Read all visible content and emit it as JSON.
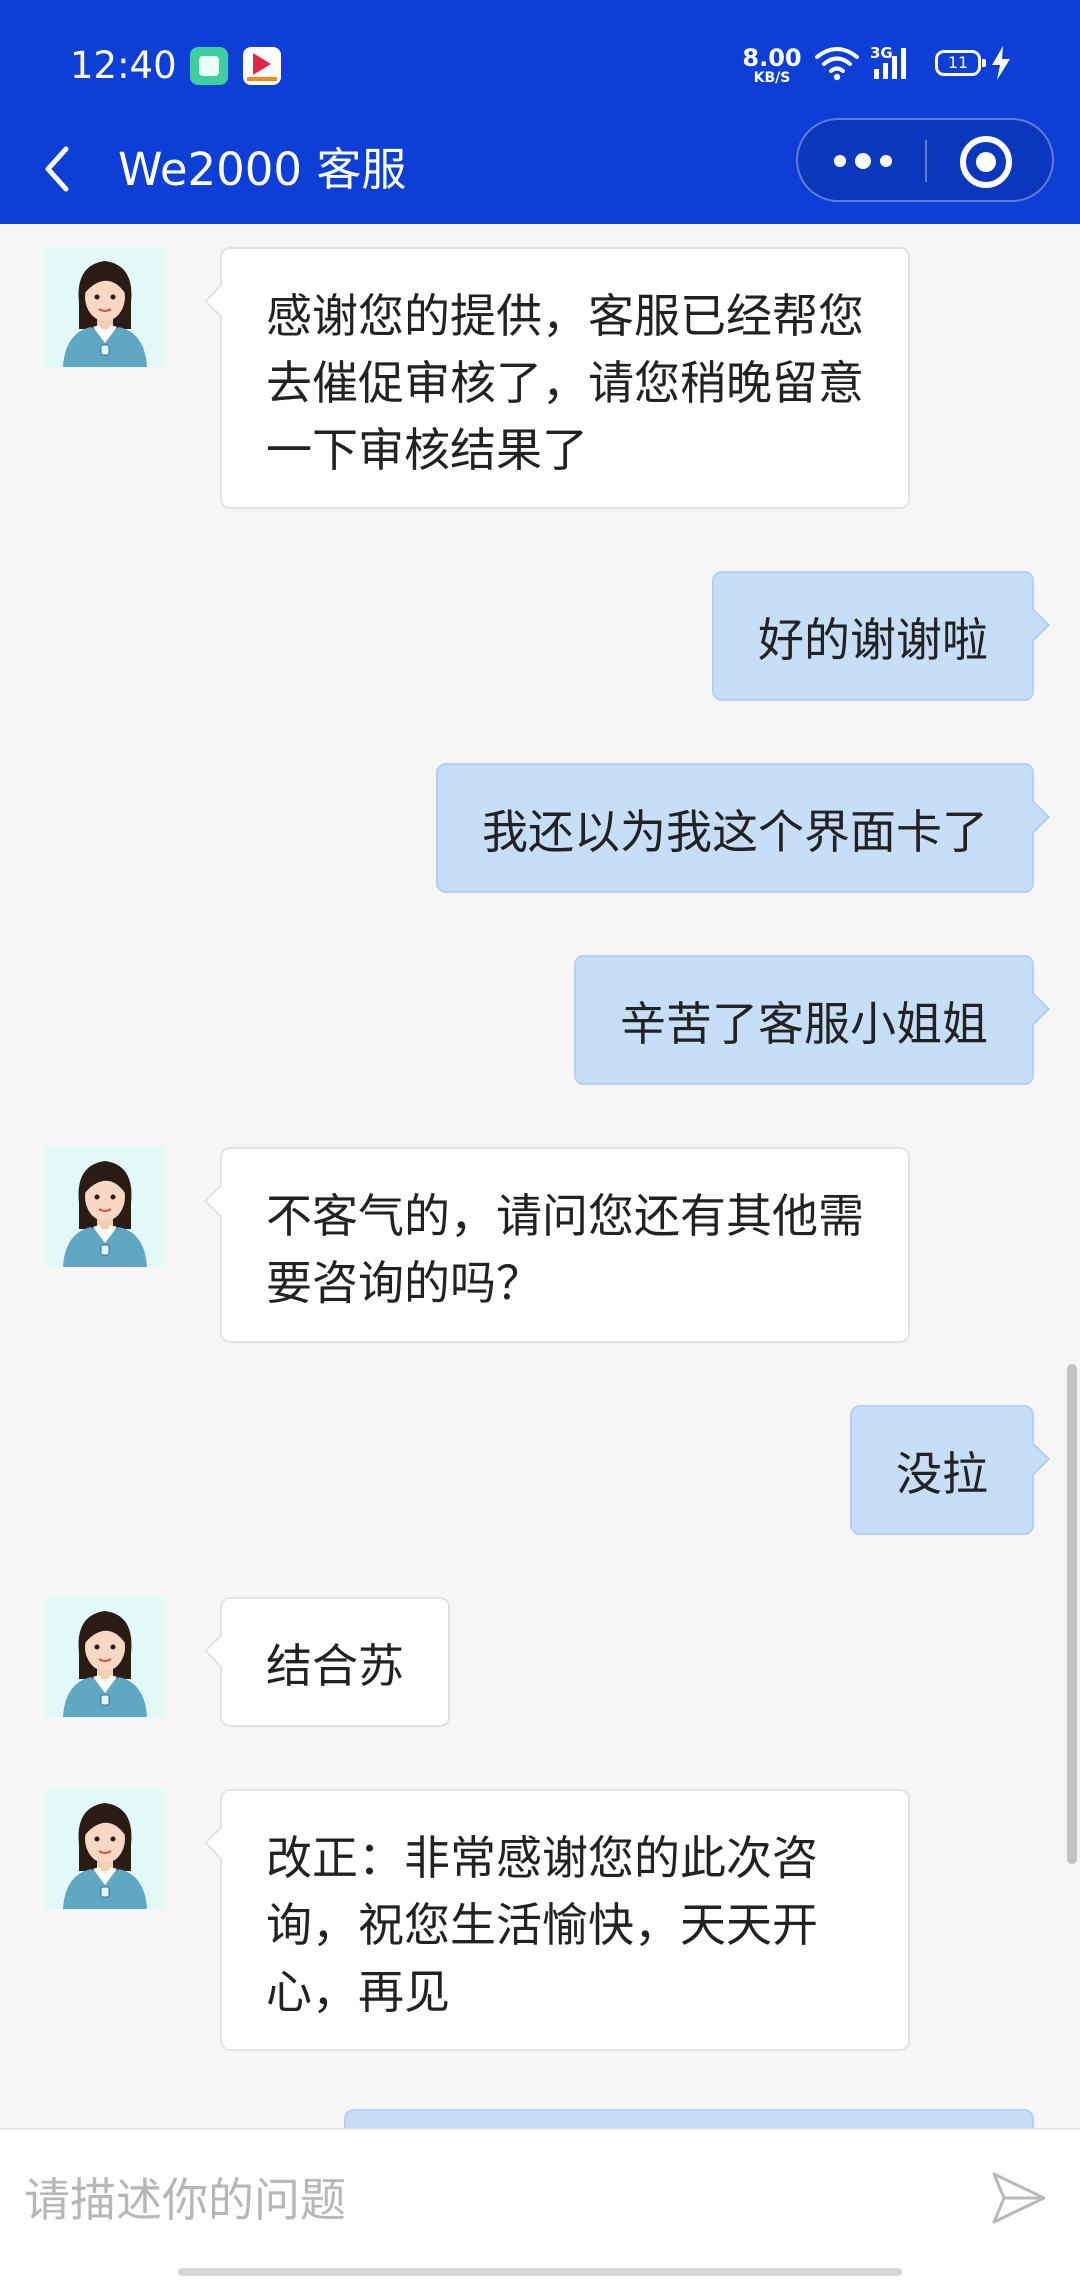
{
  "status_bar": {
    "time": "12:40",
    "net_speed_value": "8.00",
    "net_speed_unit": "KB/S",
    "network_type": "3G",
    "battery_level": "11",
    "notification_icons": [
      "app-notification-icon",
      "video-app-notification-icon"
    ]
  },
  "header": {
    "title": "We2000 客服",
    "icons": {
      "back": "chevron-left-icon",
      "more": "more-dots-icon",
      "close": "target-circle-icon"
    }
  },
  "colors": {
    "header_bg": "#0d3fd6",
    "chat_bg": "#f6f6f6",
    "agent_bubble": "#ffffff",
    "user_bubble": "#c7def9"
  },
  "messages": [
    {
      "sender": "agent",
      "text": "感谢您的提供，客服已经帮您去催促审核了，请您稍晚留意一下审核结果了"
    },
    {
      "sender": "user",
      "text": "好的谢谢啦"
    },
    {
      "sender": "user",
      "text": "我还以为我这个界面卡了"
    },
    {
      "sender": "user",
      "text": "辛苦了客服小姐姐"
    },
    {
      "sender": "agent",
      "text": "不客气的，请问您还有其他需要咨询的吗？"
    },
    {
      "sender": "user",
      "text": "没拉"
    },
    {
      "sender": "agent",
      "text": "结合苏"
    },
    {
      "sender": "agent",
      "text": "改正：非常感谢您的此次咨询，祝您生活愉快，天天开心，再见"
    }
  ],
  "input": {
    "placeholder": "请描述你的问题",
    "value": "",
    "send_icon": "send-arrow-icon"
  }
}
